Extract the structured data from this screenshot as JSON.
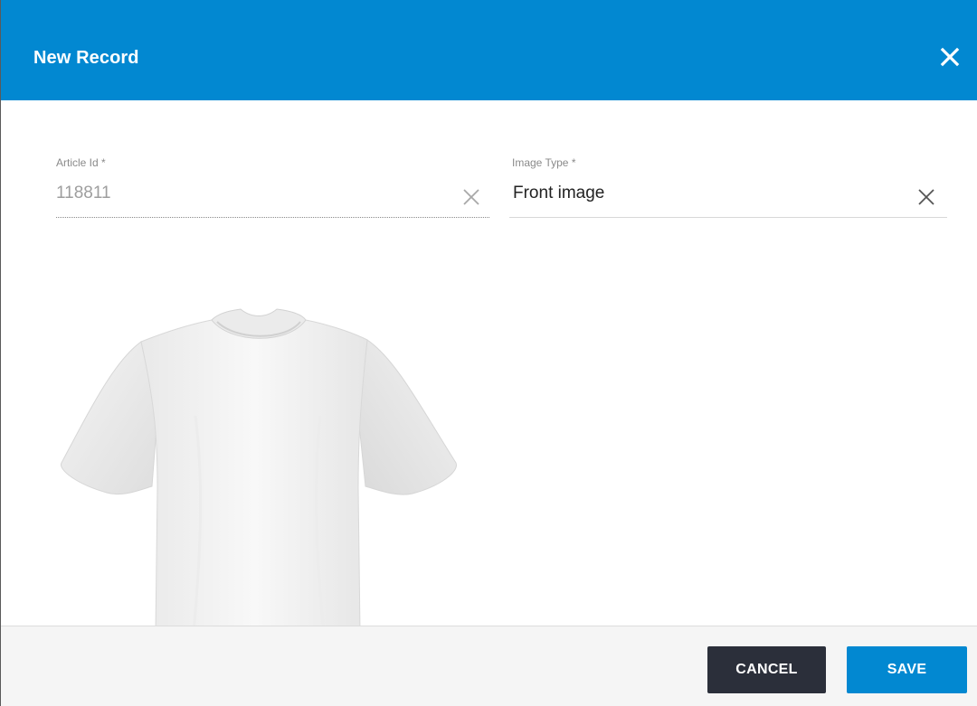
{
  "dialog": {
    "title": "New Record",
    "close_icon": "close-icon"
  },
  "fields": {
    "article_id": {
      "label": "Article Id *",
      "value": "118811",
      "clear_icon": "clear-icon"
    },
    "image_type": {
      "label": "Image Type *",
      "value": "Front image",
      "clear_icon": "clear-icon"
    }
  },
  "preview": {
    "image": "white-tshirt-front"
  },
  "footer": {
    "cancel_label": "CANCEL",
    "save_label": "SAVE"
  },
  "colors": {
    "accent": "#0288d1",
    "cancel_button": "#2b2f3a",
    "footer_background": "#f5f5f5"
  }
}
